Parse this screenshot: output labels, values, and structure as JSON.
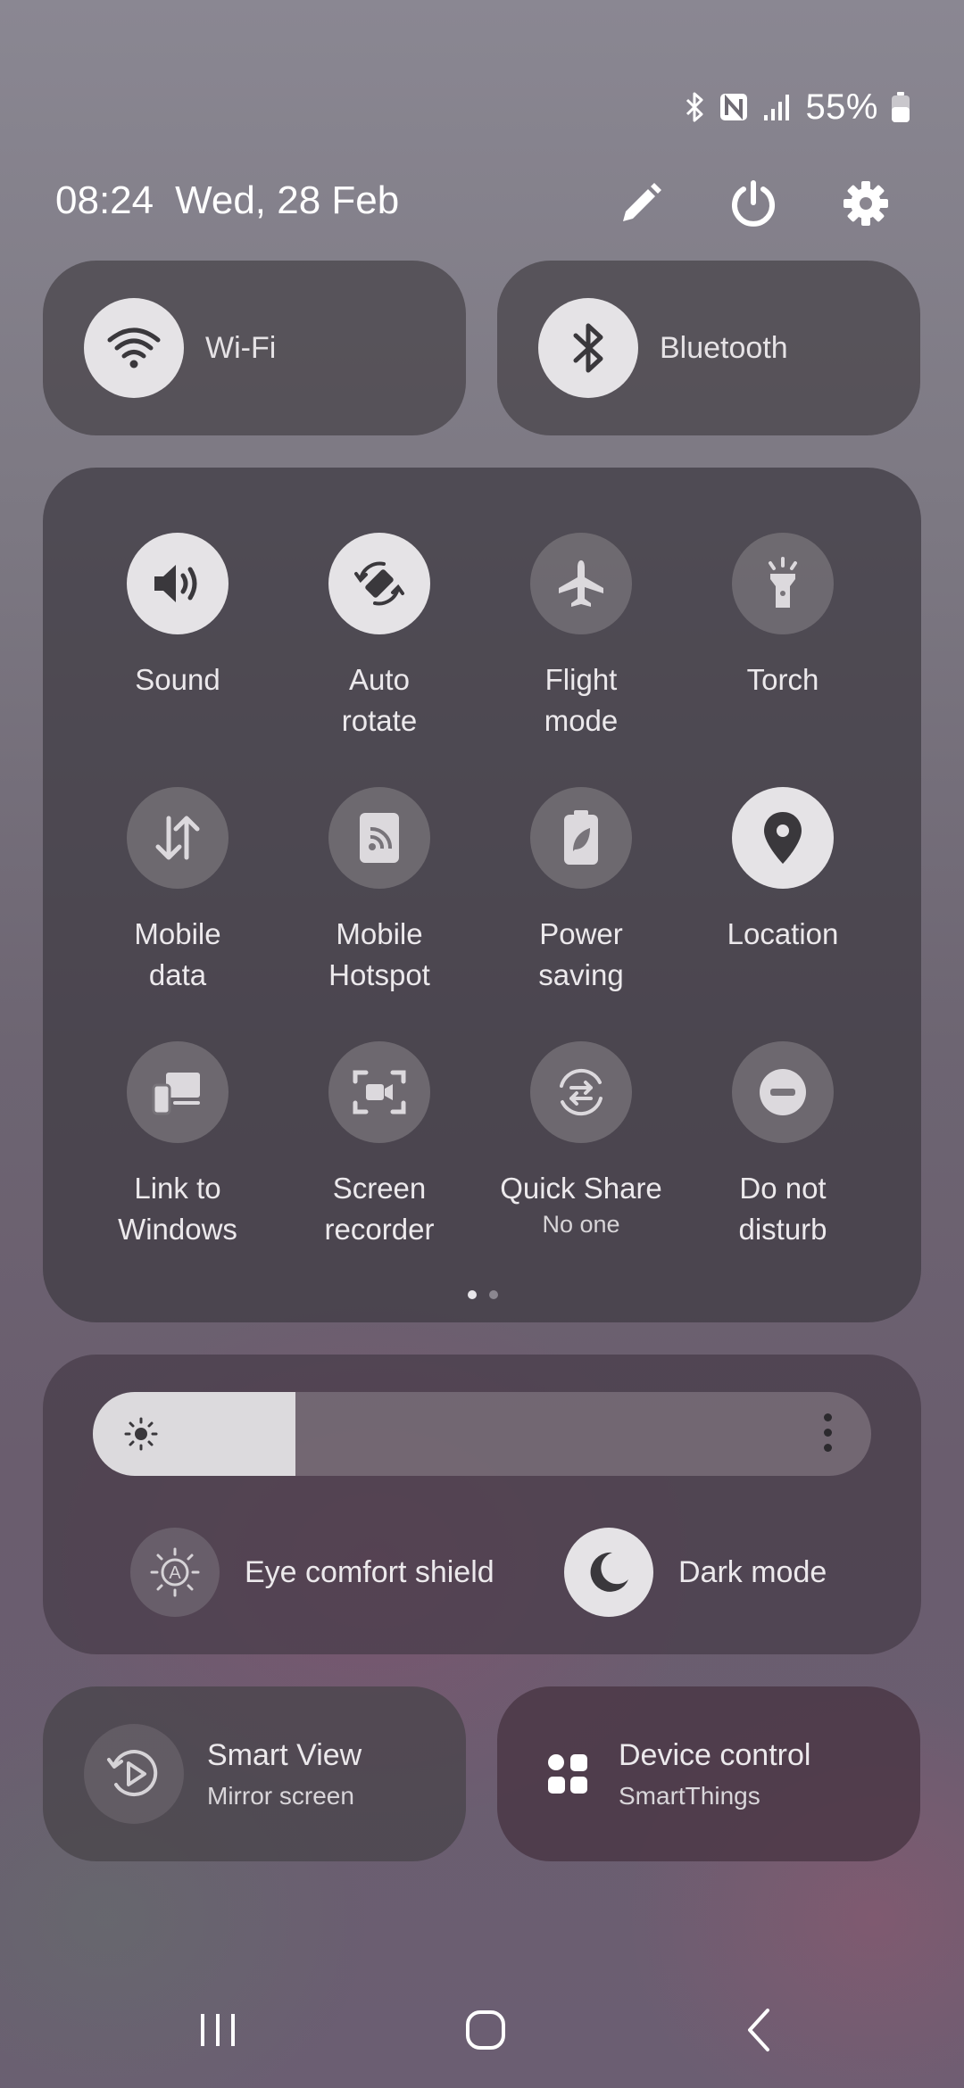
{
  "status_bar": {
    "icons": [
      "bluetooth-icon",
      "nfc-icon",
      "signal-icon",
      "battery-icon"
    ],
    "battery_percent": "55%"
  },
  "header": {
    "time": "08:24",
    "date": "Wed, 28 Feb",
    "actions": [
      "edit-icon",
      "power-icon",
      "settings-icon"
    ]
  },
  "top_tiles": [
    {
      "label": "Wi-Fi",
      "icon": "wifi-icon",
      "active": true
    },
    {
      "label": "Bluetooth",
      "icon": "bluetooth-icon",
      "active": true
    }
  ],
  "quick_settings": [
    {
      "label_line1": "Sound",
      "label_line2": "",
      "icon": "sound-icon",
      "active": true
    },
    {
      "label_line1": "Auto",
      "label_line2": "rotate",
      "icon": "auto-rotate-icon",
      "active": true
    },
    {
      "label_line1": "Flight",
      "label_line2": "mode",
      "icon": "airplane-icon",
      "active": false
    },
    {
      "label_line1": "Torch",
      "label_line2": "",
      "icon": "torch-icon",
      "active": false
    },
    {
      "label_line1": "Mobile",
      "label_line2": "data",
      "icon": "mobile-data-icon",
      "active": false
    },
    {
      "label_line1": "Mobile",
      "label_line2": "Hotspot",
      "icon": "hotspot-icon",
      "active": false
    },
    {
      "label_line1": "Power",
      "label_line2": "saving",
      "icon": "power-saving-icon",
      "active": false
    },
    {
      "label_line1": "Location",
      "label_line2": "",
      "icon": "location-icon",
      "active": true
    },
    {
      "label_line1": "Link to",
      "label_line2": "Windows",
      "icon": "link-to-windows-icon",
      "active": false
    },
    {
      "label_line1": "Screen",
      "label_line2": "recorder",
      "icon": "screen-recorder-icon",
      "active": false
    },
    {
      "label_line1": "Quick Share",
      "label_line2": "No one",
      "icon": "quick-share-icon",
      "active": false
    },
    {
      "label_line1": "Do not",
      "label_line2": "disturb",
      "icon": "do-not-disturb-icon",
      "active": false
    }
  ],
  "page_indicator": {
    "pages": 2,
    "current": 1
  },
  "brightness": {
    "level": 0.26,
    "eye_comfort_label": "Eye comfort shield",
    "dark_mode_label": "Dark mode",
    "dark_mode_active": true
  },
  "bottom_tiles": [
    {
      "title": "Smart View",
      "subtitle": "Mirror screen",
      "icon": "smart-view-icon"
    },
    {
      "title": "Device control",
      "subtitle": "SmartThings",
      "icon": "device-control-icon"
    }
  ],
  "nav_bar": [
    "recents-icon",
    "home-icon",
    "back-icon"
  ],
  "colors": {
    "tile_on": "#e5e3e6",
    "tile_off": "#78747a",
    "icon_on": "#3a383c"
  }
}
